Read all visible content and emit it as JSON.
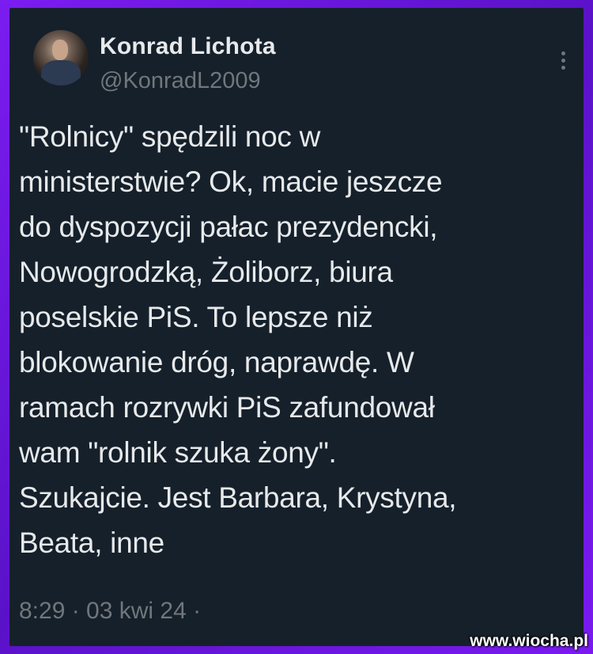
{
  "author": {
    "display_name": "Konrad Lichota",
    "handle": "@KonradL2009",
    "avatar_icon": "user-avatar"
  },
  "tweet": {
    "lines": [
      "\"Rolnicy\" spędzili noc w",
      "ministerstwie? Ok, macie jeszcze",
      "do dyspozycji pałac prezydencki,",
      "Nowogrodzką, Żoliborz, biura",
      "poselskie PiS. To lepsze niż",
      "blokowanie dróg, naprawdę. W",
      "ramach rozrywki PiS zafundował",
      "wam \"rolnik szuka żony\".",
      "Szukajcie. Jest Barbara, Krystyna,",
      "Beata, inne"
    ],
    "timestamp": "8:29 · 03 kwi 24 ·"
  },
  "watermark": "www.wiocha.pl",
  "colors": {
    "card_bg": "#15202b",
    "frame": "#6a18d8",
    "text": "#e7e9ea",
    "muted": "#71767b"
  }
}
